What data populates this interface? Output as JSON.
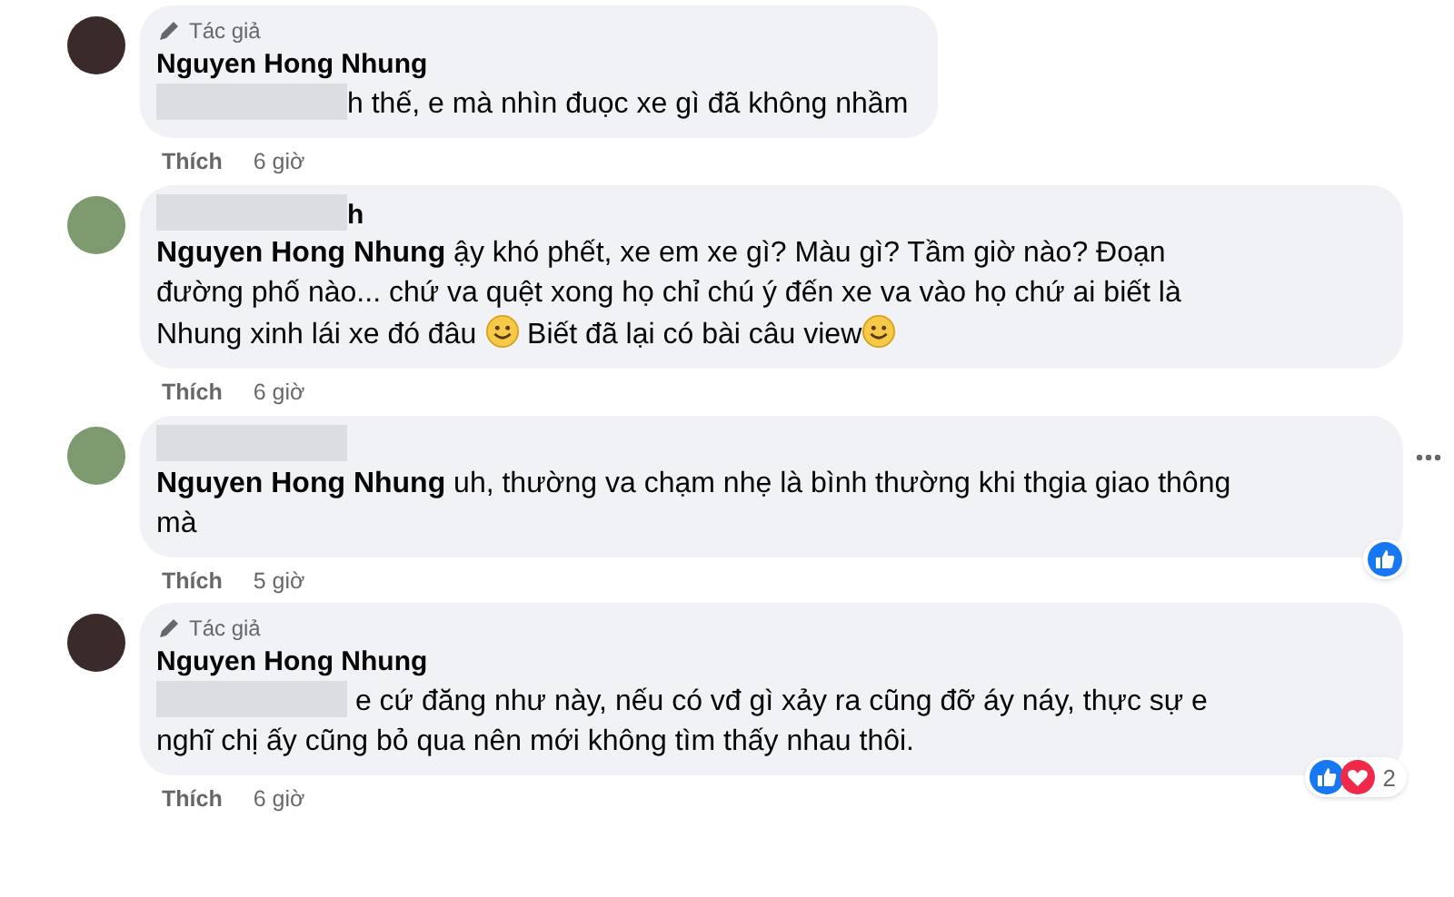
{
  "comments": [
    {
      "author_badge": "Tác giả",
      "name": [
        {
          "kind": "text",
          "text": "Nguyen Hong Nhung"
        }
      ],
      "body": [
        {
          "kind": "redacted"
        },
        {
          "kind": "text",
          "text": "h thế, e mà nhìn đuọc xe gì đã không nhầm"
        }
      ],
      "like": "Thích",
      "time": "6 giờ",
      "more": false
    },
    {
      "name": [
        {
          "kind": "redacted"
        },
        {
          "kind": "text",
          "text": "h"
        }
      ],
      "body": [
        {
          "kind": "mention",
          "text": "Nguyen Hong Nhung"
        },
        {
          "kind": "text",
          "text": " ậy khó phết, xe em xe gì? Màu gì? Tầm giờ nào? Đoạn đường phố nào... chứ va quệt xong họ chỉ chú ý đến xe va vào họ chứ ai biết là Nhung xinh lái xe đó đâu "
        },
        {
          "kind": "emoji"
        },
        {
          "kind": "text",
          "text": " Biết đã lại có bài câu view"
        },
        {
          "kind": "emoji"
        }
      ],
      "like": "Thích",
      "time": "6 giờ",
      "more": false
    },
    {
      "name": [
        {
          "kind": "redacted"
        }
      ],
      "body": [
        {
          "kind": "mention",
          "text": "Nguyen Hong Nhung"
        },
        {
          "kind": "text",
          "text": " uh, thường va chạm nhẹ là bình thường khi thgia giao thông mà"
        }
      ],
      "like": "Thích",
      "time": "5 giờ",
      "more": true,
      "reactions": {
        "icons": [
          {
            "kind": "like"
          }
        ]
      }
    },
    {
      "author_badge": "Tác giả",
      "name": [
        {
          "kind": "text",
          "text": "Nguyen Hong Nhung"
        }
      ],
      "body": [
        {
          "kind": "redacted"
        },
        {
          "kind": "text",
          "text": " e cứ đăng như này, nếu có vđ gì xảy ra cũng đỡ áy náy, thực sự e nghĩ chị ấy cũng bỏ qua nên mới không tìm thấy nhau thôi."
        }
      ],
      "like": "Thích",
      "time": "6 giờ",
      "more": false,
      "reactions": {
        "icons": [
          {
            "kind": "like"
          },
          {
            "kind": "heart"
          }
        ],
        "count": "2"
      }
    }
  ]
}
